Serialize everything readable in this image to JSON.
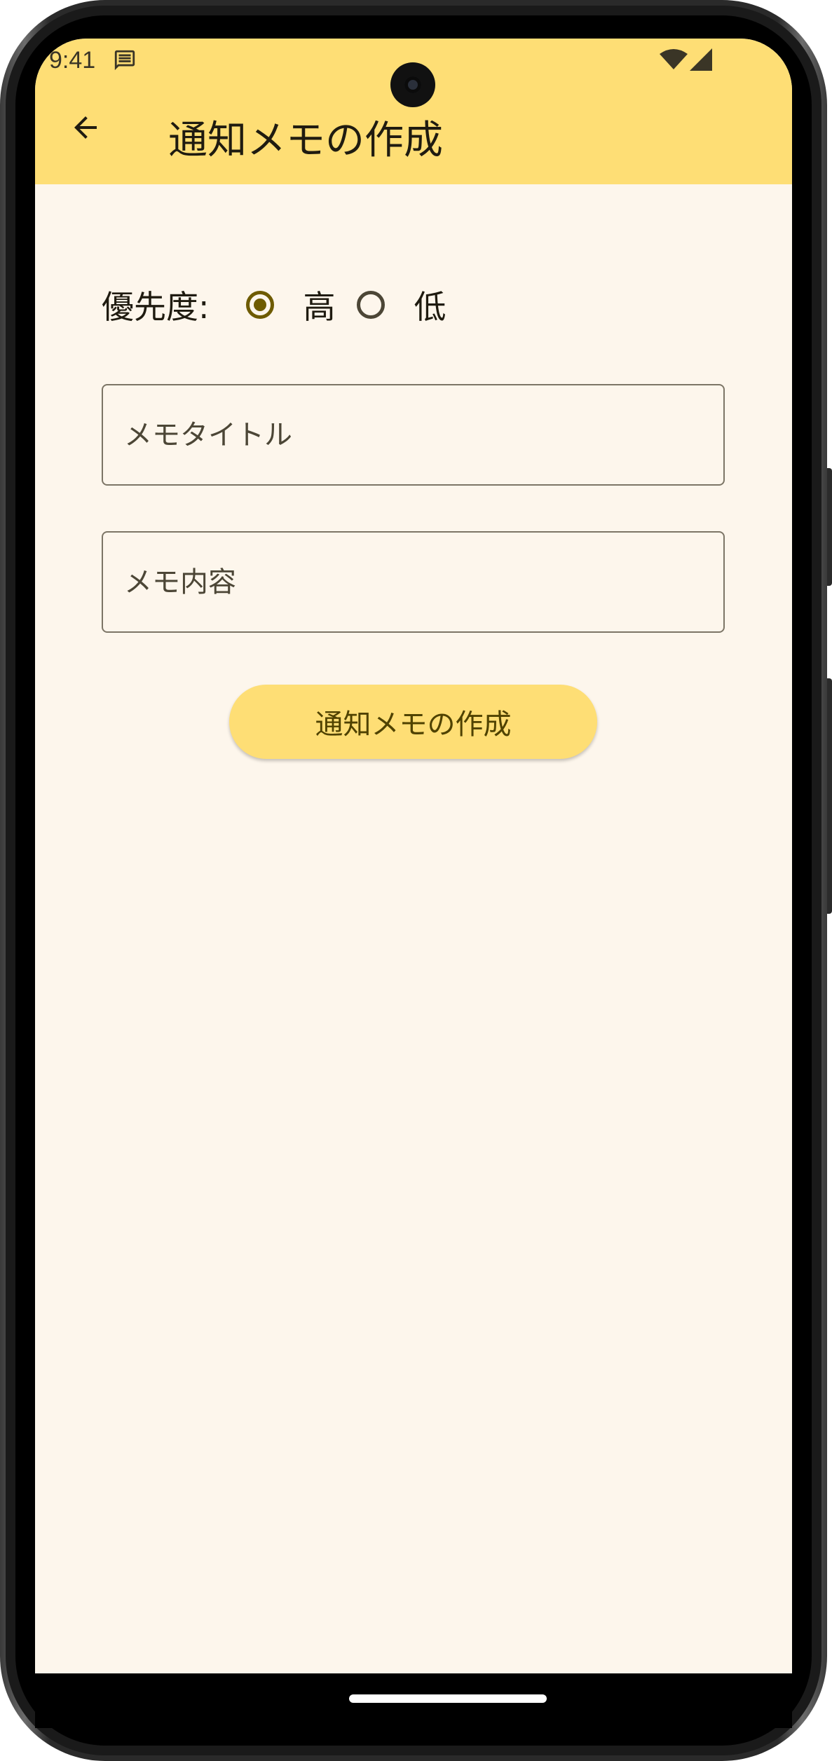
{
  "status_bar": {
    "time": "9:41",
    "icons": [
      "message-icon",
      "wifi-icon",
      "signal-icon"
    ]
  },
  "app_bar": {
    "back_icon": "arrow-left-icon",
    "title": "通知メモの作成"
  },
  "form": {
    "priority": {
      "label": "優先度:",
      "options": [
        {
          "label": "高",
          "selected": true
        },
        {
          "label": "低",
          "selected": false
        }
      ]
    },
    "title_field": {
      "placeholder": "メモタイトル",
      "value": ""
    },
    "body_field": {
      "placeholder": "メモ内容",
      "value": ""
    },
    "submit_label": "通知メモの作成"
  },
  "colors": {
    "app_bar": "#fede75",
    "background": "#fdf6ec",
    "radio_selected": "#6e5b00",
    "button": "#fede75",
    "button_text": "#4f4200"
  }
}
